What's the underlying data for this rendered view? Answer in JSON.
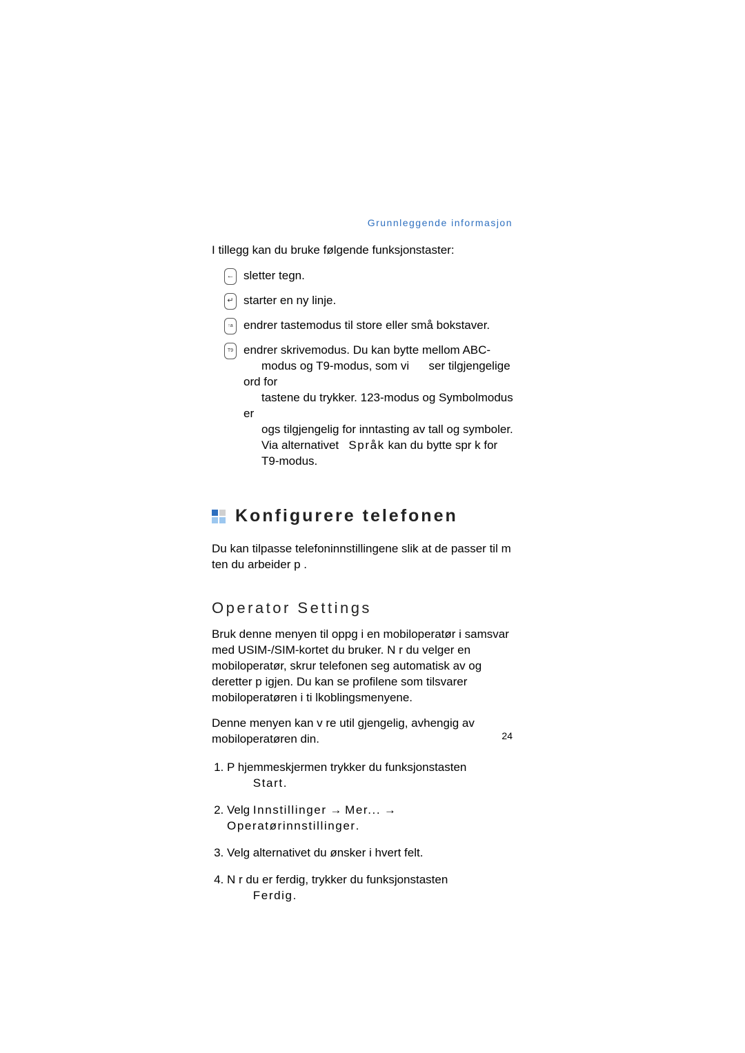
{
  "header": {
    "running": "Grunnleggende informasjon"
  },
  "intro": "I tillegg kan du bruke følgende funksjonstaster:",
  "keys": {
    "k1": {
      "glyph": "←",
      "text": "sletter tegn."
    },
    "k2": {
      "glyph": "↵",
      "text": "starter en ny linje."
    },
    "k3": {
      "glyph": "↑a",
      "text": "endrer tastemodus til store eller små bokstaver."
    },
    "k4": {
      "glyph": "T9",
      "line1": "endrer skrivemodus. Du kan bytte mellom ABC-",
      "line2_a": "modus og T9-modus, som vi",
      "line2_b": "ser tilgjengelige ord for",
      "line3": "tastene du trykker. 123-modus og Symbolmodus er",
      "line4_a": "ogs",
      "line4_b": " tilgjengelig for inntasting av tall og symboler.",
      "line5_a": "Via alternativet ",
      "line5_b": "Språk",
      "line5_c": " kan du bytte spr k for",
      "line6": "T9-modus."
    }
  },
  "section": {
    "title": "Konfigurere telefonen",
    "para": "Du kan tilpasse telefoninnstillingene slik at de passer til m ten du arbeider p ."
  },
  "sub": {
    "heading": "Operator Settings",
    "p1": "Bruk denne menyen til   oppg        i en mobiloperatør i samsvar med USIM-/SIM-kortet du bruker. N r du velger en mobiloperatør, skrur telefonen seg automatisk av og deretter p  igjen. Du kan se profilene som tilsvarer mobiloperatøren i ti      lkoblingsmenyene.",
    "p2": "Denne menyen kan v re util        gjengelig, avhengig av mobiloperatøren din."
  },
  "steps": {
    "s1_a": "P  hjemmeskjermen trykker du funksjonstasten ",
    "s1_b": "Start",
    "s1_c": ".",
    "s2_a": "Velg ",
    "s2_b": "Innstillinger",
    "s2_c": " → ",
    "s2_d": "Mer...",
    "s2_e": " → ",
    "s2_f": "Operatørinnstillinger",
    "s2_g": ".",
    "s3": "Velg alternativet du ønsker i hvert felt.",
    "s4_a": "N r du er ferdig, trykker du funksjonstasten ",
    "s4_b": "Ferdig",
    "s4_c": "."
  },
  "pageNumber": "24"
}
